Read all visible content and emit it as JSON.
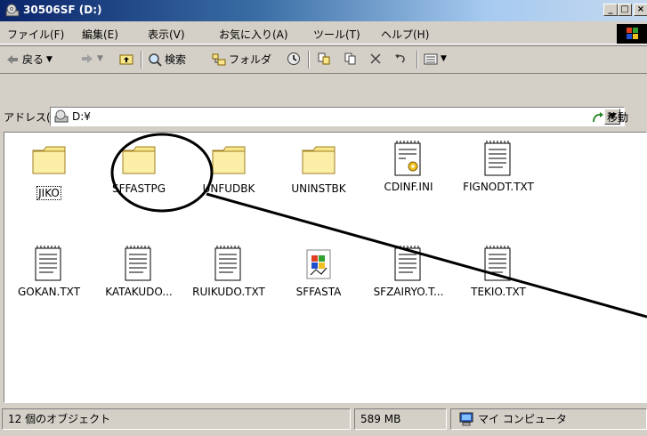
{
  "window": {
    "title": "30506SF (D:)",
    "controls": [
      "_",
      "□",
      "×"
    ]
  },
  "menu": [
    "ファイル(F)",
    "編集(E)",
    "表示(V)",
    "お気に入り(A)",
    "ツール(T)",
    "ヘルプ(H)"
  ],
  "toolbar": {
    "back": "戻る",
    "search": "検索",
    "folders": "フォルダ"
  },
  "address": {
    "label": "アドレス(D)",
    "value": "D:¥",
    "go": "移動"
  },
  "files": [
    {
      "name": "JIKO",
      "type": "folder"
    },
    {
      "name": "SFFASTPG",
      "type": "folder"
    },
    {
      "name": "UNFUDBK",
      "type": "folder"
    },
    {
      "name": "UNINSTBK",
      "type": "folder"
    },
    {
      "name": "CDINF.INI",
      "type": "ini"
    },
    {
      "name": "FIGNODT.TXT",
      "type": "txt"
    },
    {
      "name": "GOKAN.TXT",
      "type": "txt"
    },
    {
      "name": "KATAKUDO...",
      "type": "txt"
    },
    {
      "name": "RUIKUDO.TXT",
      "type": "txt"
    },
    {
      "name": "SFFASTA",
      "type": "exe"
    },
    {
      "name": "SFZAIRYO.T...",
      "type": "txt"
    },
    {
      "name": "TEKIO.TXT",
      "type": "txt"
    }
  ],
  "status": {
    "objects": "12 個のオブジェクト",
    "size": "589 MB",
    "location": "マイ コンピュータ"
  },
  "colors": {
    "title_active": "#0a246a",
    "folder": "#f7e68a",
    "annotation": "#000000"
  }
}
